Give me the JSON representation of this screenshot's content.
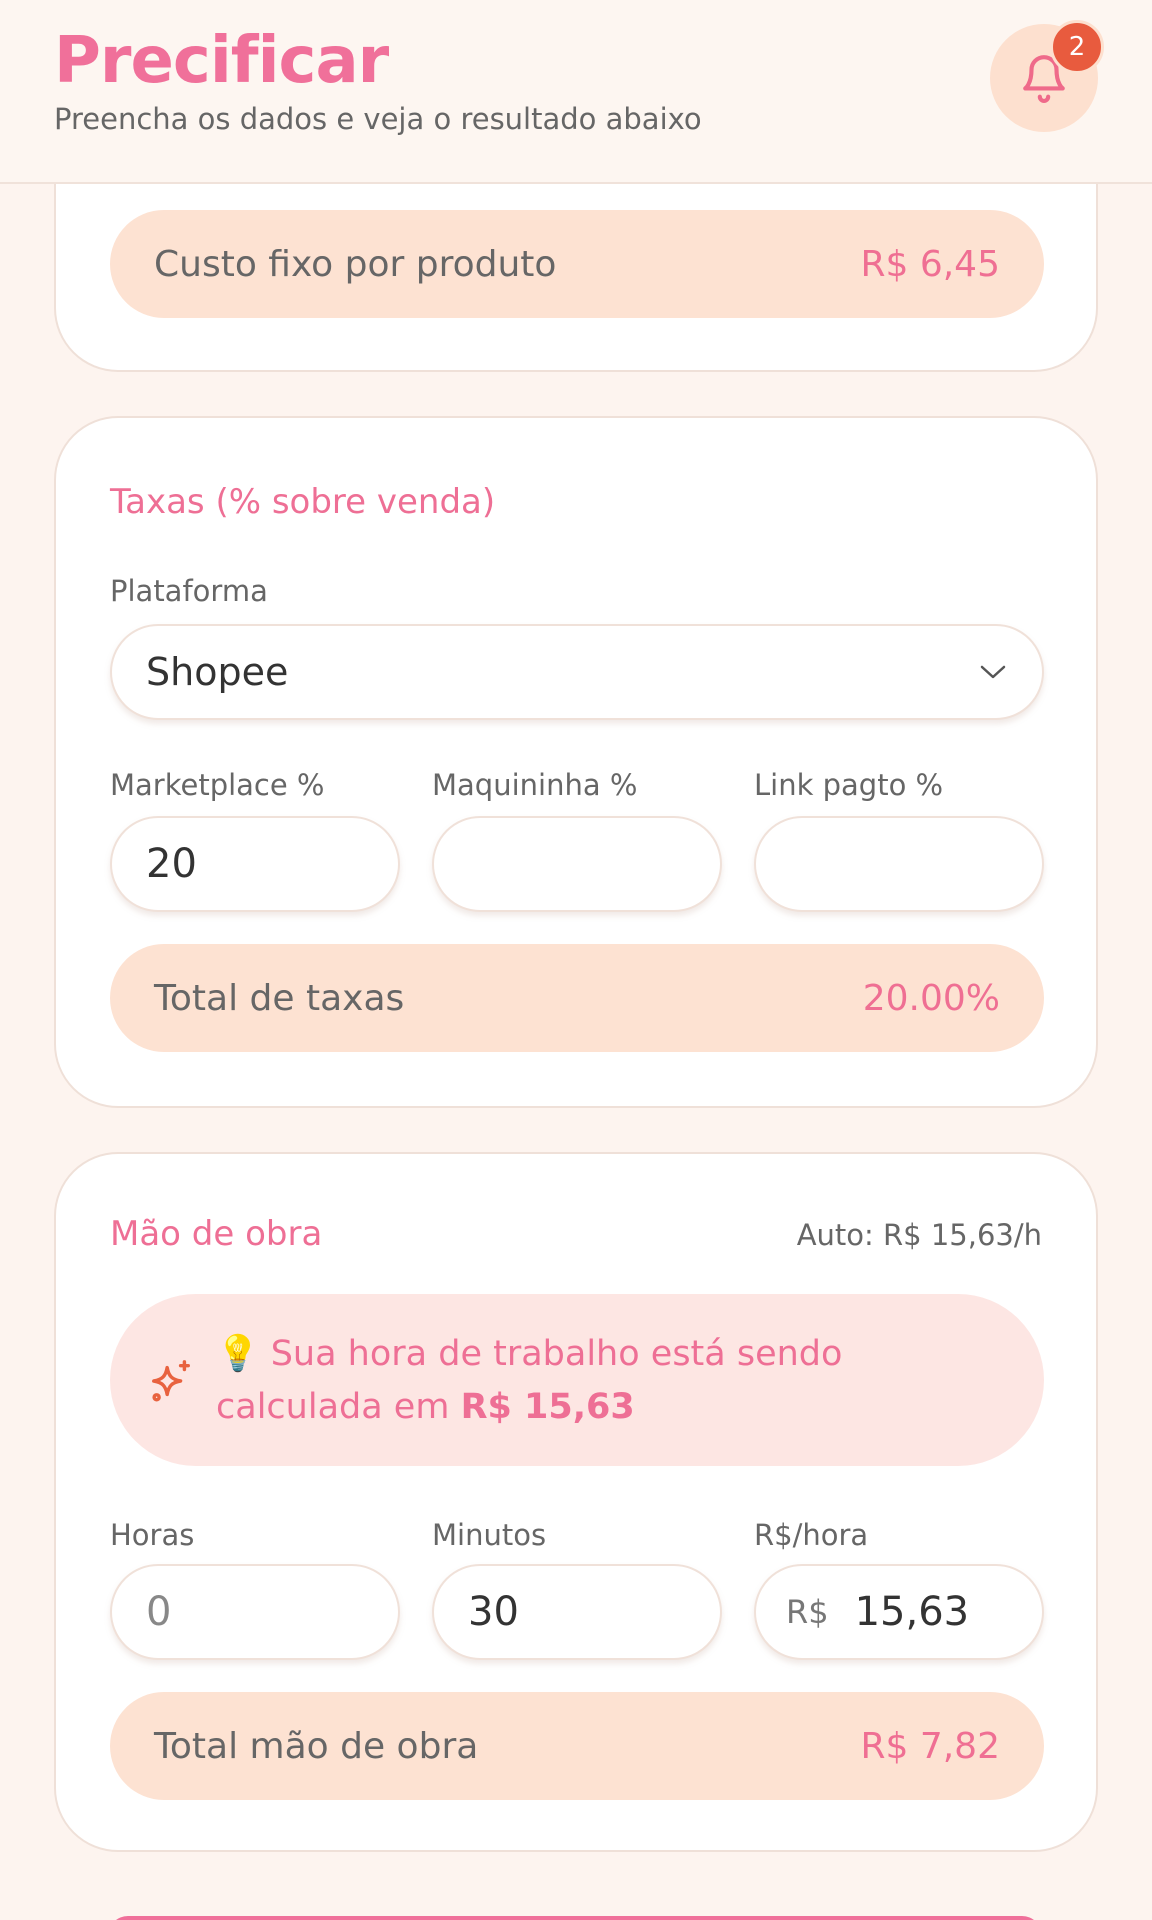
{
  "header": {
    "title": "Precificar",
    "subtitle": "Preencha os dados e veja o resultado abaixo",
    "notification_count": "2"
  },
  "fixed_cost": {
    "label": "Custo fixo por produto",
    "value": "R$ 6,45"
  },
  "fees": {
    "title": "Taxas (% sobre venda)",
    "platform_label": "Plataforma",
    "platform_value": "Shopee",
    "marketplace_label": "Marketplace %",
    "marketplace_value": "20",
    "card_machine_label": "Maquininha %",
    "card_machine_value": "",
    "payment_link_label": "Link pagto %",
    "payment_link_value": "",
    "total_label": "Total de taxas",
    "total_value": "20.00%"
  },
  "labor": {
    "title": "Mão de obra",
    "auto_rate": "Auto: R$ 15,63/h",
    "info_prefix": "💡 Sua hora de trabalho está sendo calculada em ",
    "info_value": "R$ 15,63",
    "hours_label": "Horas",
    "hours_value": "0",
    "minutes_label": "Minutos",
    "minutes_value": "30",
    "rate_label": "R$/hora",
    "rate_prefix": "R$",
    "rate_value": "15,63",
    "total_label": "Total mão de obra",
    "total_value": "R$ 7,82"
  },
  "colors": {
    "brand": "#f0709a",
    "accent_bg": "#fde2d2",
    "info_bg": "#fde6e3",
    "badge": "#e85b3e"
  }
}
